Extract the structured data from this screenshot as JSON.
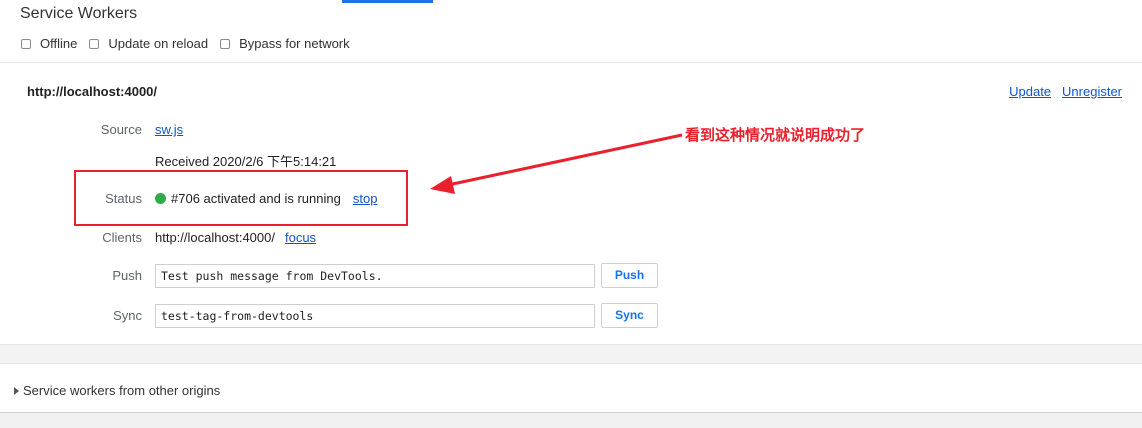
{
  "section": {
    "title": "Service Workers",
    "options": [
      {
        "label": "Offline",
        "checked": false
      },
      {
        "label": "Update on reload",
        "checked": false
      },
      {
        "label": "Bypass for network",
        "checked": false
      }
    ]
  },
  "worker": {
    "scope_url": "http://localhost:4000/",
    "update_label": "Update",
    "unregister_label": "Unregister",
    "source": {
      "label": "Source",
      "link": "sw.js"
    },
    "received": "Received 2020/2/6 下午5:14:21",
    "status": {
      "label": "Status",
      "text": "#706 activated and is running",
      "stop_label": "stop",
      "color": "#2eaa4b"
    },
    "clients": {
      "label": "Clients",
      "url": "http://localhost:4000/",
      "focus_label": "focus"
    },
    "push": {
      "label": "Push",
      "value": "Test push message from DevTools.",
      "button": "Push"
    },
    "sync": {
      "label": "Sync",
      "value": "test-tag-from-devtools",
      "button": "Sync"
    }
  },
  "annotation": {
    "text": "看到这种情况就说明成功了",
    "color": "#e8212d"
  },
  "other_origins": {
    "label": "Service workers from other origins",
    "icon": "disclosure-triangle-icon"
  }
}
